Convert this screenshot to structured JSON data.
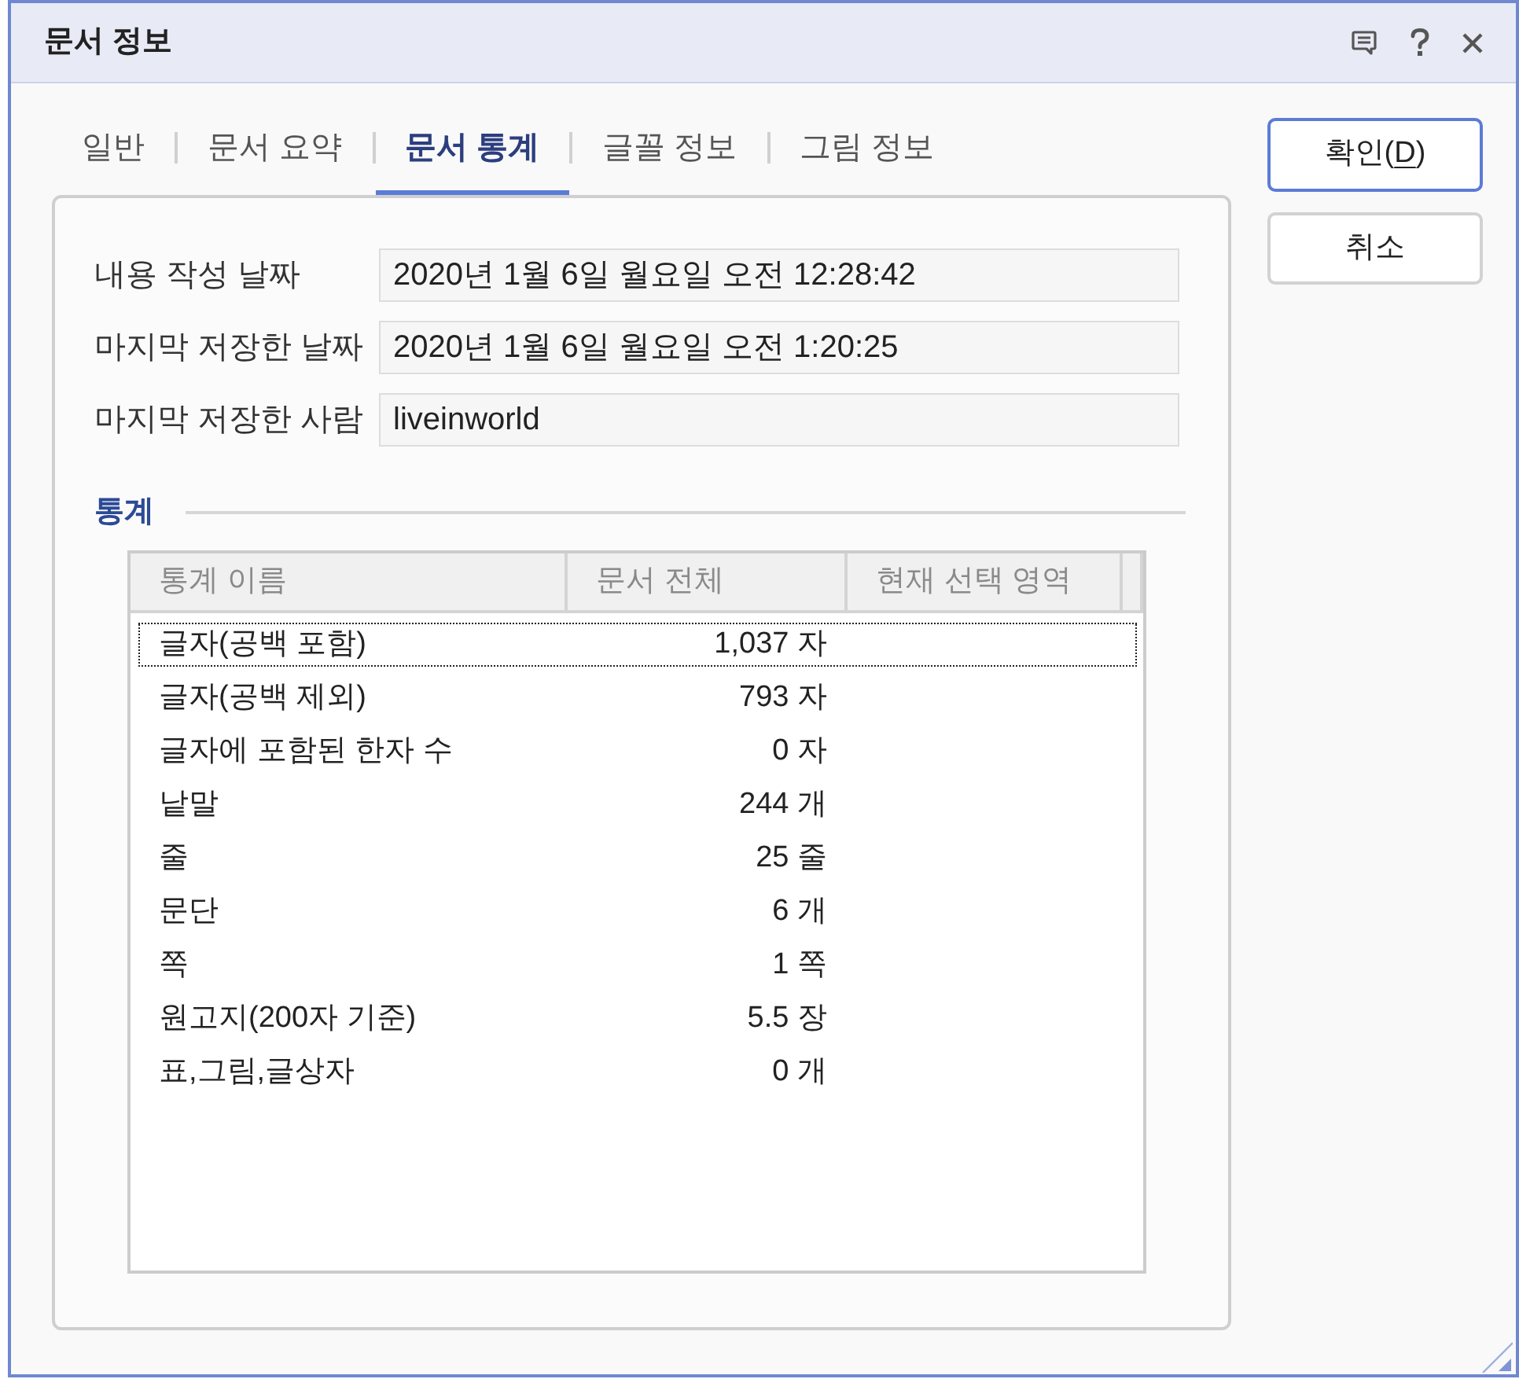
{
  "window": {
    "title": "문서 정보"
  },
  "tabs": [
    {
      "label": "일반",
      "selected": false
    },
    {
      "label": "문서 요약",
      "selected": false
    },
    {
      "label": "문서 통계",
      "selected": true
    },
    {
      "label": "글꼴 정보",
      "selected": false
    },
    {
      "label": "그림 정보",
      "selected": false
    }
  ],
  "properties": [
    {
      "label": "내용 작성 날짜",
      "value": "2020년 1월 6일 월요일 오전 12:28:42"
    },
    {
      "label": "마지막 저장한 날짜",
      "value": "2020년 1월 6일 월요일 오전 1:20:25"
    },
    {
      "label": "마지막 저장한 사람",
      "value": "liveinworld"
    }
  ],
  "statistics": {
    "title": "통계",
    "table": {
      "columns": [
        "통계 이름",
        "문서 전체",
        "현재 선택 영역"
      ],
      "rows": [
        {
          "name": "글자(공백 포함)",
          "document_total": "1,037 자",
          "focused": true
        },
        {
          "name": "글자(공백 제외)",
          "document_total": "793 자",
          "focused": false
        },
        {
          "name": "글자에 포함된 한자 수",
          "document_total": "0 자",
          "focused": false
        },
        {
          "name": "낱말",
          "document_total": "244 개",
          "focused": false
        },
        {
          "name": "줄",
          "document_total": "25 줄",
          "focused": false
        },
        {
          "name": "문단",
          "document_total": "6 개",
          "focused": false
        },
        {
          "name": "쪽",
          "document_total": "1 쪽",
          "focused": false
        },
        {
          "name": "원고지(200자 기준)",
          "document_total": "5.5 장",
          "focused": false
        },
        {
          "name": "표,그림,글상자",
          "document_total": "0 개",
          "focused": false
        }
      ]
    }
  },
  "buttons": [
    {
      "default": true,
      "label": [
        {
          "text": "확인(",
          "mnemonic": false
        },
        {
          "text": "D",
          "mnemonic": true
        },
        {
          "text": ")",
          "mnemonic": false
        }
      ]
    },
    {
      "default": false,
      "label": [
        {
          "text": "취소",
          "mnemonic": false
        }
      ]
    }
  ]
}
